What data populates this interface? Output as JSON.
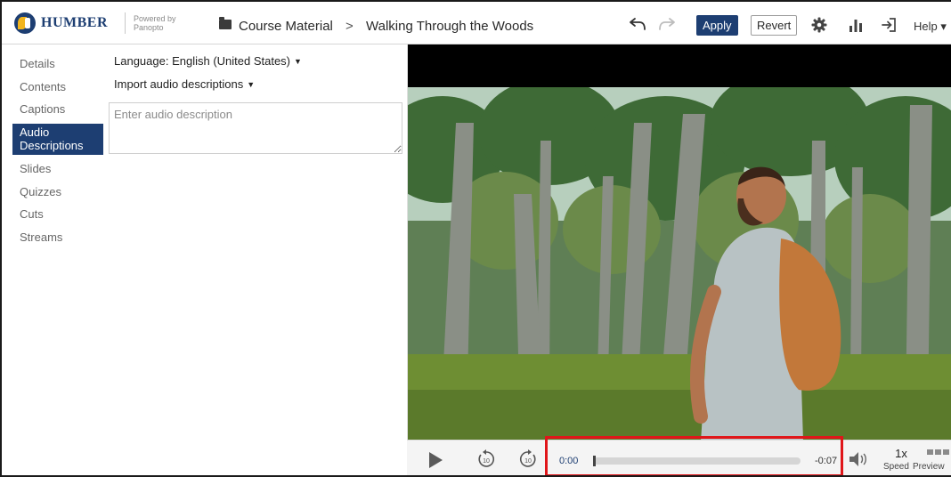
{
  "header": {
    "brand": "HUMBER",
    "powered_by": [
      "Powered by",
      "Panopto"
    ],
    "breadcrumb_folder": "Course Material",
    "breadcrumb_sep": ">",
    "breadcrumb_page": "Walking Through the Woods",
    "apply_label": "Apply",
    "revert_label": "Revert",
    "help_label": "Help ▾"
  },
  "sidebar": {
    "items": [
      {
        "label": "Details"
      },
      {
        "label": "Contents"
      },
      {
        "label": "Captions"
      },
      {
        "label": "Audio Descriptions",
        "active": true
      },
      {
        "label": "Slides"
      },
      {
        "label": "Quizzes"
      },
      {
        "label": "Cuts"
      },
      {
        "label": "Streams"
      }
    ]
  },
  "editor": {
    "language_label": "Language: English (United States)",
    "import_label": "Import audio descriptions",
    "description_placeholder": "Enter audio description",
    "description_value": ""
  },
  "player": {
    "current_time": "0:00",
    "remaining_time": "-0:07",
    "progress_fraction": 0.0,
    "speed_value": "1x",
    "speed_label": "Speed",
    "preview_label": "Preview"
  },
  "colors": {
    "brand": "#1d3e72",
    "accent_gold": "#f2b51d",
    "highlight": "#e0161a"
  },
  "icons": [
    "folder-icon",
    "undo-icon",
    "redo-icon",
    "gear-icon",
    "stats-icon",
    "exit-icon",
    "play-icon",
    "rewind-10-icon",
    "forward-10-icon",
    "volume-icon",
    "preview-icon"
  ]
}
